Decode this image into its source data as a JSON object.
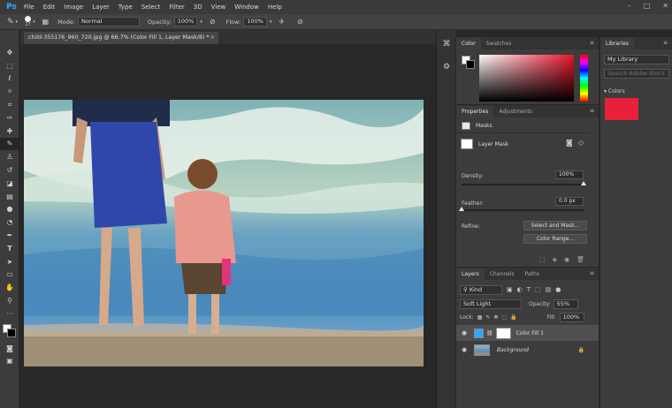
{
  "menu": {
    "logo": "Ps",
    "items": [
      "File",
      "Edit",
      "Image",
      "Layer",
      "Type",
      "Select",
      "Filter",
      "3D",
      "View",
      "Window",
      "Help"
    ]
  },
  "window_controls": [
    "–",
    "□",
    "✕"
  ],
  "options": {
    "brush_size": "17",
    "mode_label": "Mode:",
    "mode_value": "Normal",
    "opacity_label": "Opacity:",
    "opacity_value": "100%",
    "flow_label": "Flow:",
    "flow_value": "100%"
  },
  "document": {
    "tab_title": "child-355176_960_720.jpg @ 66.7% (Color Fill 1, Layer Mask/8) *",
    "close": "×"
  },
  "color_panel": {
    "tabs": [
      "Color",
      "Swatches"
    ]
  },
  "properties": {
    "tabs": [
      "Properties",
      "Adjustments"
    ],
    "masks_label": "Masks",
    "layer_mask_label": "Layer Mask",
    "density_label": "Density:",
    "density_value": "100%",
    "density_level": 1.0,
    "feather_label": "Feather:",
    "feather_value": "0.0 px",
    "feather_level": 0.0,
    "refine_label": "Refine:",
    "select_mask_button": "Select and Mask...",
    "color_range_button": "Color Range..."
  },
  "layers": {
    "tabs": [
      "Layers",
      "Channels",
      "Paths"
    ],
    "kind_label": "Kind",
    "blend_mode": "Soft Light",
    "opacity_label": "Opacity:",
    "opacity_value": "55%",
    "lock_label": "Lock:",
    "fill_label": "Fill:",
    "fill_value": "100%",
    "items": [
      {
        "name": "Color Fill 1",
        "selected": true
      },
      {
        "name": "Background",
        "selected": false
      }
    ]
  },
  "libraries": {
    "tab": "Libraries",
    "library_name": "My Library",
    "search_placeholder": "Search Adobe Stock",
    "colors_heading": "Colors",
    "swatch_color": "#e8213a"
  },
  "colors": {
    "accent": "#31a8ff",
    "picked": "#e8142a"
  }
}
